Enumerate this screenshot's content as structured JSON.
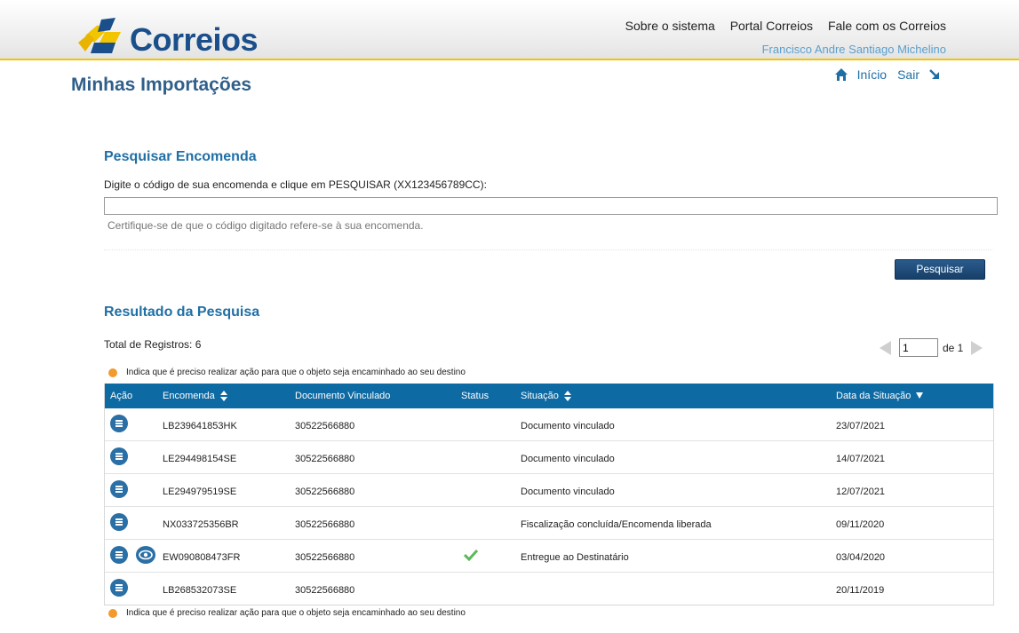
{
  "header": {
    "logo_text": "Correios",
    "links": [
      "Sobre o sistema",
      "Portal Correios",
      "Fale com os Correios"
    ],
    "user_name": "Francisco Andre Santiago Michelino",
    "brand_yellow": "#f2c500",
    "brand_blue": "#1a4f8b"
  },
  "page": {
    "title": "Minhas Importações",
    "nav_home": "Início",
    "nav_exit": "Sair"
  },
  "search": {
    "title": "Pesquisar Encomenda",
    "instruction": "Digite o código de sua encomenda e clique em PESQUISAR (XX123456789CC):",
    "input_value": "",
    "hint": "Certifique-se de que o código digitado refere-se à sua encomenda.",
    "button": "Pesquisar"
  },
  "results": {
    "title": "Resultado da Pesquisa",
    "total": "Total de Registros: 6",
    "page_value": "1",
    "page_of": "de 1",
    "legend": "Indica que é preciso realizar ação para que o objeto seja encaminhado ao seu destino",
    "columns": [
      "Ação",
      "Encomenda",
      "Documento Vinculado",
      "Status",
      "Situação",
      "Data da Situação"
    ],
    "rows": [
      {
        "encomenda": "LB239641853HK",
        "documento": "30522566880",
        "status": "",
        "situacao": "Documento vinculado",
        "data": "23/07/2021",
        "eye": false
      },
      {
        "encomenda": "LE294498154SE",
        "documento": "30522566880",
        "status": "",
        "situacao": "Documento vinculado",
        "data": "14/07/2021",
        "eye": false
      },
      {
        "encomenda": "LE294979519SE",
        "documento": "30522566880",
        "status": "",
        "situacao": "Documento vinculado",
        "data": "12/07/2021",
        "eye": false
      },
      {
        "encomenda": "NX033725356BR",
        "documento": "30522566880",
        "status": "",
        "situacao": "Fiscalização concluída/Encomenda liberada",
        "data": "09/11/2020",
        "eye": false
      },
      {
        "encomenda": "EW090808473FR",
        "documento": "30522566880",
        "status": "check",
        "situacao": "Entregue ao Destinatário",
        "data": "03/04/2020",
        "eye": true
      },
      {
        "encomenda": "LB268532073SE",
        "documento": "30522566880",
        "status": "",
        "situacao": "",
        "data": "20/11/2019",
        "eye": false
      }
    ],
    "header_color": "#0e6aa3",
    "legend_dot_color": "#f29a2e",
    "check_color": "#5cb85c"
  }
}
